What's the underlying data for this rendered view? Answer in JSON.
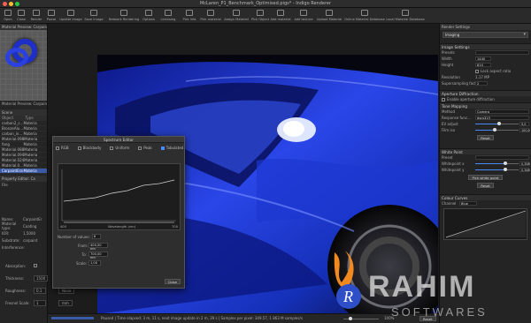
{
  "window": {
    "title": "McLaren_P1_Benchmark_Optimised.pigs* - Indigo Renderer"
  },
  "toolbar": {
    "items": [
      {
        "label": "Open"
      },
      {
        "label": "Close"
      },
      {
        "label": "Render"
      },
      {
        "label": "Pause"
      },
      {
        "label": "Update image"
      },
      {
        "label": "Save image"
      },
      {
        "label": "Network Rendering"
      },
      {
        "label": "Options"
      },
      {
        "label": "Licensing"
      },
      {
        "label": "Pick info"
      },
      {
        "label": "Pick material"
      },
      {
        "label": "Assign Material"
      },
      {
        "label": "Pick Object"
      },
      {
        "label": "Add material"
      },
      {
        "label": "Add texture"
      },
      {
        "label": "Upload Material"
      },
      {
        "label": "Online Material Database"
      },
      {
        "label": "Local Material Database"
      }
    ]
  },
  "left": {
    "preview_header": "Material Preview: CarpaintEra",
    "preview_caption": "Material Preview: CarpaintEra",
    "opengl_label": "OpenGL preview",
    "scene_header": "Scene",
    "scene_columns": [
      "Object",
      "Type"
    ],
    "scene_rows": [
      {
        "name": "carbon2_s...",
        "type": "Materia",
        "selected": false
      },
      {
        "name": "BronzeAlu...",
        "type": "Materia",
        "selected": false
      },
      {
        "name": "carbon_in...",
        "type": "Materia",
        "selected": false
      },
      {
        "name": "Material.098",
        "type": "Materia",
        "selected": false
      },
      {
        "name": "fang",
        "type": "Materia",
        "selected": false
      },
      {
        "name": "Material.088",
        "type": "Materia",
        "selected": false
      },
      {
        "name": "Material.094",
        "type": "Materia",
        "selected": false
      },
      {
        "name": "Material.024",
        "type": "Materia",
        "selected": false
      },
      {
        "name": "Material.0...",
        "type": "Materia",
        "selected": false
      },
      {
        "name": "CarpaintEra",
        "type": "Materia",
        "selected": true
      }
    ],
    "prop_header": "Property Editor: Ca",
    "file_label": "File",
    "props": [
      {
        "label": "Name:",
        "value": "CarpaintEr"
      },
      {
        "label": "Material type:",
        "value": "Coating"
      },
      {
        "label": "IOR:",
        "value": "1,5000"
      },
      {
        "label": "Substrate:",
        "value": "carpaint"
      },
      {
        "label": "Interference:",
        "value": ""
      }
    ],
    "lower_props": [
      {
        "label": "Absorption:",
        "value": ""
      },
      {
        "label": "Thickness:",
        "value": "1500"
      },
      {
        "label": "Roughness:",
        "value": "0,1"
      },
      {
        "label": "Fresnel Scale:",
        "value": "1"
      }
    ],
    "units": [
      "None",
      "mm"
    ]
  },
  "dialog": {
    "title": "Spectrum Editor",
    "options": [
      "RGB",
      "Blackbody",
      "Uniform",
      "Peak",
      "Tabulated"
    ],
    "selected_option": "Tabulated",
    "graph_xmin": "400",
    "graph_xmax": "700",
    "graph_xlabel": "Wavelength (nm)",
    "num_values_label": "Number of values:",
    "num_values": "8",
    "from_label": "From:",
    "from_value": "400,00 nm",
    "to_label": "To:",
    "to_value": "700,00 nm",
    "scale_label": "Scale:",
    "scale_value": "1,00",
    "close_label": "Close"
  },
  "right": {
    "header": "Render Settings",
    "mode": "Imaging",
    "image_settings_title": "Image Settings",
    "presets_label": "Presets",
    "width_label": "Width",
    "width_value": "1440",
    "height_label": "Height",
    "height_value": "810",
    "lock_aspect_label": "Lock aspect ratio",
    "resolution_label": "Resolution",
    "resolution_value": "1.17 MP",
    "supersampling_label": "Supersampling factor",
    "supersampling_value": "2",
    "aperture_title": "Aperture Diffraction",
    "aperture_enable": "Enable aperture diffraction",
    "tone_title": "Tone Mapping",
    "method_label": "Method",
    "method_value": "Camera",
    "response_label": "Response func...",
    "response_value": "dscs315",
    "ev_label": "EV adjust",
    "ev_value": "9,0",
    "ev_fraction": 0.55,
    "film_label": "Film iso",
    "film_value": "100,0",
    "film_fraction": 0.45,
    "reset_label": "Reset",
    "white_title": "White Point",
    "preset_label": "Preset",
    "wx_label": "Whitepoint x",
    "wx_value": "0,358",
    "wx_fraction": 0.7,
    "wy_label": "Whitepoint y",
    "wy_value": "0,348",
    "wy_fraction": 0.7,
    "pick_white_label": "Pick white point",
    "reset2_label": "Reset",
    "curves_title": "Colour Curves",
    "channel_label": "Channel",
    "channel_value": "Blue"
  },
  "status": {
    "text": "Paused | Time elapsed: 3 m, 11 s, next image update in 2 m, 39 s | Samples per pixel: 349.57, 1 863 M samples/s",
    "zoom": "100%",
    "reset": "Reset"
  },
  "watermark": {
    "big": "RAHIM",
    "small": "SOFTWARES"
  },
  "colors": {
    "accent": "#4a8cff",
    "car_blue": "#1f3bd8",
    "selection": "#3b5ba7"
  }
}
